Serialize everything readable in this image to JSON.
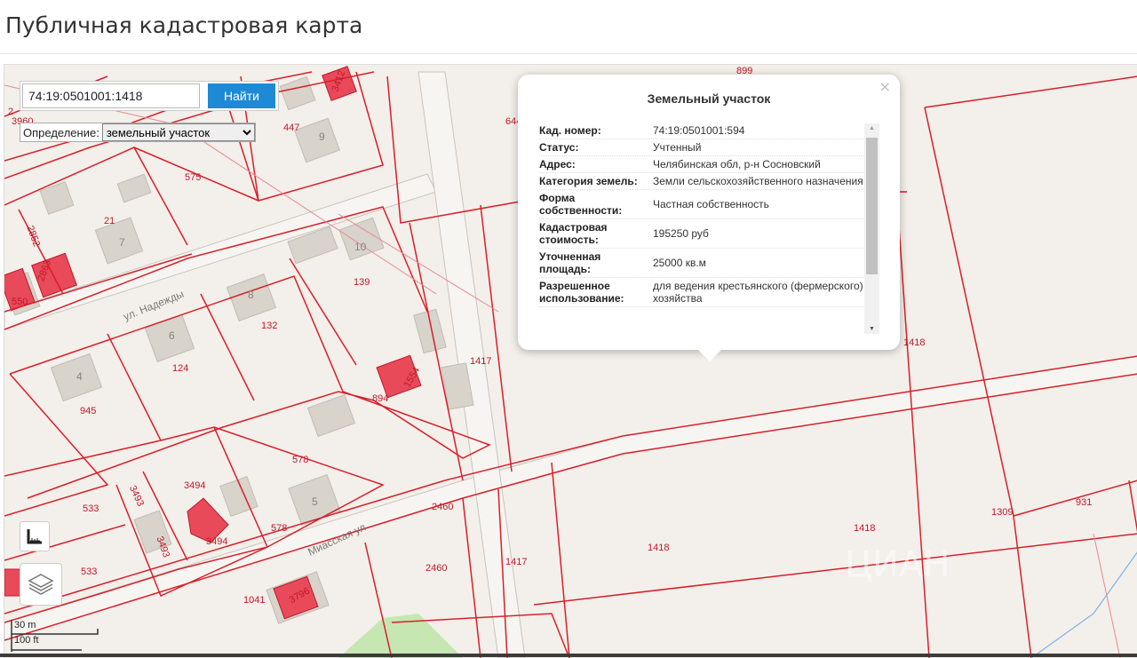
{
  "page": {
    "title": "Публичная кадастровая карта"
  },
  "search": {
    "value": "74:19:0501001:1418",
    "button_label": "Найти"
  },
  "definition": {
    "label": "Определение:",
    "selected": "земельный участок"
  },
  "popup": {
    "title": "Земельный участок",
    "close_label": "×",
    "rows": [
      {
        "key": "Кад. номер:",
        "value": "74:19:0501001:594"
      },
      {
        "key": "Статус:",
        "value": "Учтенный"
      },
      {
        "key": "Адрес:",
        "value": "Челябинская обл, р-н Сосновский"
      },
      {
        "key": "Категория земель:",
        "value": "Земли сельскохозяйственного назначения"
      },
      {
        "key": "Форма собственности:",
        "value": "Частная собственность"
      },
      {
        "key": "Кадастровая стоимость:",
        "value": "195250 руб"
      },
      {
        "key": "Уточненная площадь:",
        "value": "25000 кв.м"
      },
      {
        "key": "Разрешенное использование:",
        "value": "для ведения крестьянского (фермерского) хозяйства"
      }
    ]
  },
  "map": {
    "parcel_labels": [
      "899",
      "3412",
      "2",
      "3960",
      "447",
      "575",
      "2852",
      "21",
      "2863",
      "10",
      "139",
      "132",
      "124",
      "945",
      "894",
      "1554",
      "1417",
      "578",
      "3494",
      "3493",
      "2460",
      "533",
      "1041",
      "3796",
      "1418",
      "1309",
      "931",
      "644",
      "550"
    ],
    "building_labels": [
      "9",
      "7",
      "8",
      "6",
      "4",
      "5"
    ],
    "streets": {
      "nadezhdy": "ул. Надежды",
      "miasskaya": "Миасская ул"
    },
    "watermark": "ЦИАН",
    "colors": {
      "parcel_line": "#d81f2a",
      "selected_parcel": "#e84a5a",
      "building": "#d8d3cb",
      "park": "#c6e6b2"
    }
  },
  "scale": {
    "metric": "30 m",
    "imperial": "100 ft"
  },
  "icons": {
    "ruler": "ruler-icon",
    "layers": "layers-icon"
  }
}
